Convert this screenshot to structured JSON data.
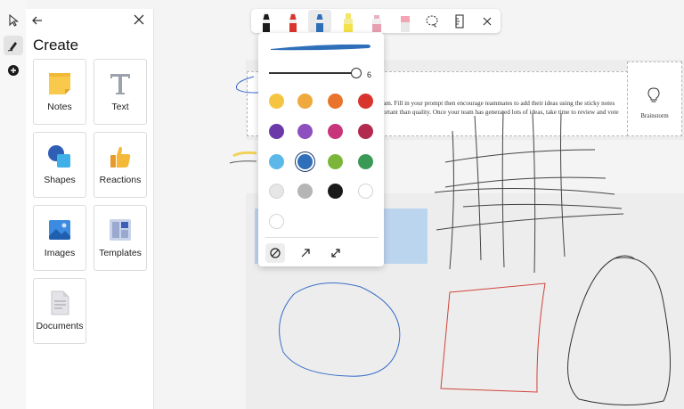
{
  "panel": {
    "title": "Create",
    "tiles": [
      {
        "label": "Notes",
        "icon": "sticky-note-icon"
      },
      {
        "label": "Text",
        "icon": "text-t-icon"
      },
      {
        "label": "Shapes",
        "icon": "shapes-icon"
      },
      {
        "label": "Reactions",
        "icon": "thumbs-up-icon"
      },
      {
        "label": "Images",
        "icon": "image-icon"
      },
      {
        "label": "Templates",
        "icon": "templates-icon"
      },
      {
        "label": "Documents",
        "icon": "document-icon"
      }
    ]
  },
  "pen_popup": {
    "thickness_value": "6",
    "selected_color": "#2f6fba",
    "colors": [
      "#f5c542",
      "#f0a93c",
      "#e8742e",
      "#d9352f",
      "#6b3aa8",
      "#8e4fbf",
      "#c8357a",
      "#b22a4e",
      "#5bb8e8",
      "#2f6fba",
      "#7bb63a",
      "#3a9a55",
      "#e6e6e6",
      "#b5b5b5",
      "#1a1a1a",
      "#ffffff",
      "#ffffff"
    ]
  },
  "board": {
    "template_text_line1": "am. Fill in your prompt then encourage teammates to add their ideas using the sticky notes",
    "template_text_line2": "ortant than quality. Once your team has generated lots of ideas, take time to review and vote",
    "brainstorm_label": "Brainstorm"
  },
  "colors": {
    "accent_blue": "#2f6fba",
    "board_bg": "#ededed"
  }
}
